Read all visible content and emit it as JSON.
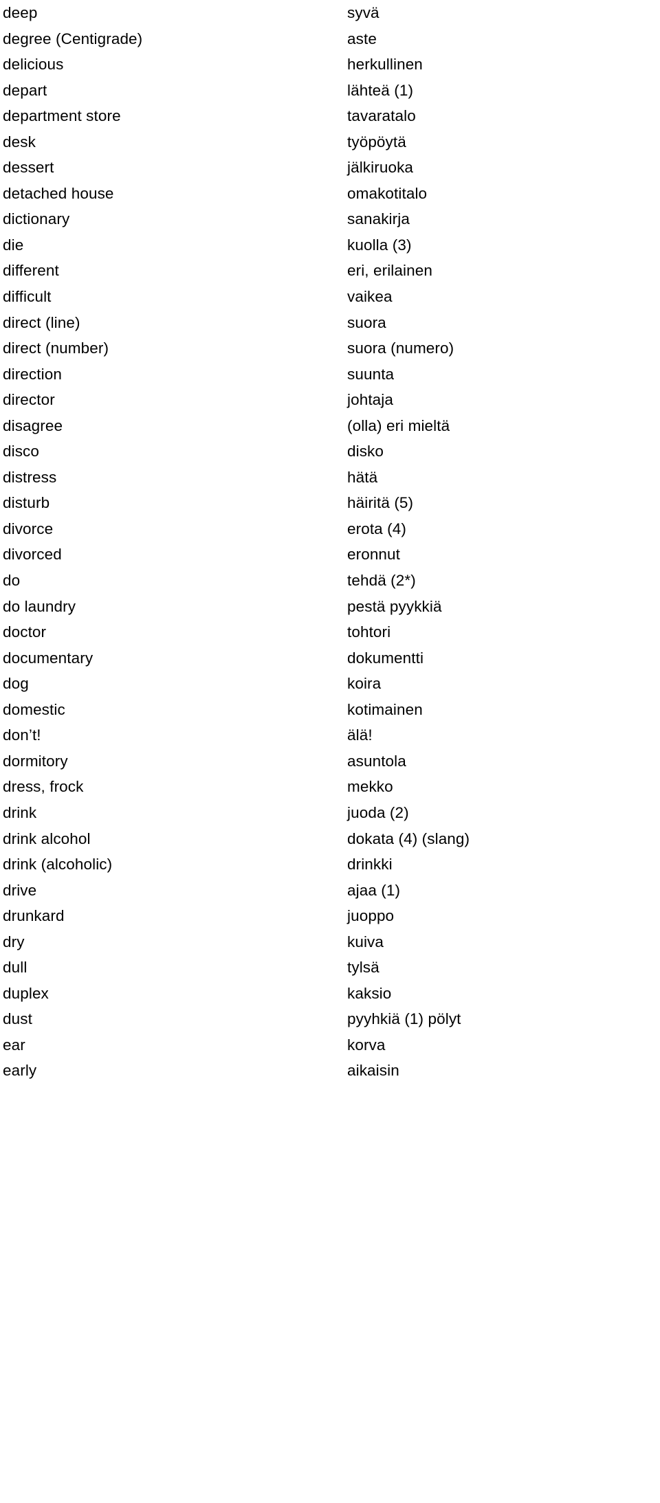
{
  "document": {
    "kind": "bilingual-glossary",
    "source_language_label": "English",
    "target_language_label": "Finnish"
  },
  "entries": [
    {
      "term": "deep",
      "gloss": "syvä"
    },
    {
      "term": "degree (Centigrade)",
      "gloss": "aste"
    },
    {
      "term": "delicious",
      "gloss": "herkullinen"
    },
    {
      "term": "depart",
      "gloss": "lähteä (1)"
    },
    {
      "term": "department store",
      "gloss": "tavaratalo"
    },
    {
      "term": "desk",
      "gloss": "työpöytä"
    },
    {
      "term": "dessert",
      "gloss": "jälkiruoka"
    },
    {
      "term": "detached house",
      "gloss": "omakotitalo"
    },
    {
      "term": "dictionary",
      "gloss": "sanakirja"
    },
    {
      "term": "die",
      "gloss": "kuolla (3)"
    },
    {
      "term": "different",
      "gloss": "eri, erilainen"
    },
    {
      "term": "difficult",
      "gloss": "vaikea"
    },
    {
      "term": "direct (line)",
      "gloss": "suora"
    },
    {
      "term": "direct (number)",
      "gloss": "suora (numero)"
    },
    {
      "term": "direction",
      "gloss": "suunta"
    },
    {
      "term": "director",
      "gloss": "johtaja"
    },
    {
      "term": "disagree",
      "gloss": "(olla) eri mieltä"
    },
    {
      "term": "disco",
      "gloss": "disko"
    },
    {
      "term": "distress",
      "gloss": "hätä"
    },
    {
      "term": "disturb",
      "gloss": "häiritä (5)"
    },
    {
      "term": "divorce",
      "gloss": "erota (4)"
    },
    {
      "term": "divorced",
      "gloss": "eronnut"
    },
    {
      "term": "do",
      "gloss": "tehdä (2*)"
    },
    {
      "term": "do laundry",
      "gloss": "pestä pyykkiä"
    },
    {
      "term": "doctor",
      "gloss": "tohtori"
    },
    {
      "term": "documentary",
      "gloss": "dokumentti"
    },
    {
      "term": "dog",
      "gloss": "koira"
    },
    {
      "term": "domestic",
      "gloss": "kotimainen"
    },
    {
      "term": "don’t!",
      "gloss": "älä!"
    },
    {
      "term": "dormitory",
      "gloss": "asuntola"
    },
    {
      "term": "dress, frock",
      "gloss": "mekko"
    },
    {
      "term": "drink",
      "gloss": "juoda (2)"
    },
    {
      "term": "drink alcohol",
      "gloss": "dokata (4) (slang)"
    },
    {
      "term": "drink (alcoholic)",
      "gloss": "drinkki"
    },
    {
      "term": "drive",
      "gloss": "ajaa (1)"
    },
    {
      "term": "drunkard",
      "gloss": "juoppo"
    },
    {
      "term": "dry",
      "gloss": "kuiva"
    },
    {
      "term": "dull",
      "gloss": "tylsä"
    },
    {
      "term": "duplex",
      "gloss": "kaksio"
    },
    {
      "term": "dust",
      "gloss": "pyyhkiä (1) pölyt"
    },
    {
      "term": "ear",
      "gloss": "korva"
    },
    {
      "term": "early",
      "gloss": "aikaisin"
    }
  ]
}
